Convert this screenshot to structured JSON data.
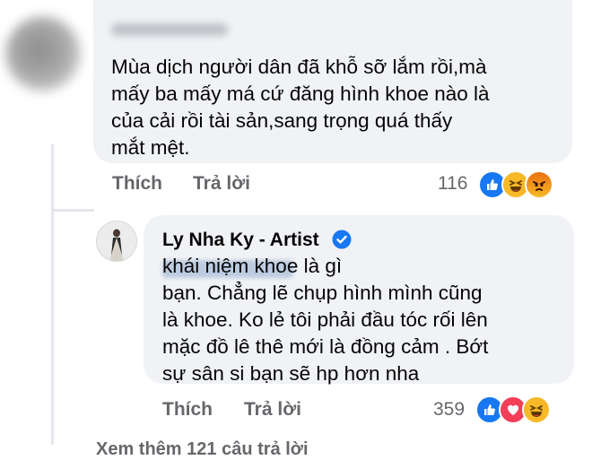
{
  "comment1": {
    "text": "Mùa dịch người dân đã khỗ sỡ lắm rồi,mà\nmấy ba mấy má cứ đăng hình khoe nào là\ncủa cải rồi tài sản,sang trọng quá thấy\nmắt mệt.",
    "like_label": "Thích",
    "reply_label": "Trả lời",
    "reaction_count": "116",
    "reactions": [
      "like-icon",
      "haha-icon",
      "angry-icon"
    ]
  },
  "reply1": {
    "author": "Ly Nha Ky - Artist",
    "text": "                          khái niệm khoe là gì\nbạn. Chẳng lẽ chụp hình mình cũng\nlà khoe. Ko lẻ tôi phải đầu tóc rối lên\nmặc đồ lê thê mới là đồng cảm . Bớt\nsự sân si bạn sẽ hp hơn nha",
    "like_label": "Thích",
    "reply_label": "Trả lời",
    "reaction_count": "359",
    "reactions": [
      "like-icon",
      "love-icon",
      "haha-icon"
    ]
  },
  "more_replies_label": "Xem thêm 121 câu trả lời",
  "colors": {
    "bubble": "#f0f2f5",
    "secondary_text": "#65676b",
    "like": "#1877f2",
    "love": "#f33e58",
    "haha": "#f7b928"
  }
}
